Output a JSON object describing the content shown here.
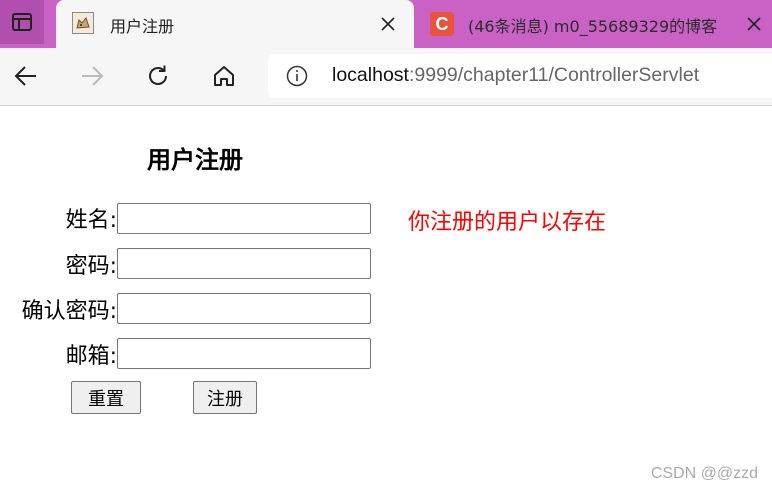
{
  "browser": {
    "active_tab": {
      "title": "用户注册"
    },
    "inactive_tab": {
      "title": "(46条消息) m0_55689329的博客"
    },
    "address": {
      "host": "localhost",
      "path": ":9999/chapter11/ControllerServlet"
    }
  },
  "form": {
    "title": "用户注册",
    "fields": {
      "name_label": "姓名:",
      "password_label": "密码:",
      "confirm_label": "确认密码:",
      "email_label": "邮箱:"
    },
    "error": "你注册的用户以存在",
    "reset_label": "重置",
    "submit_label": "注册"
  },
  "watermark": "CSDN @@zzd"
}
